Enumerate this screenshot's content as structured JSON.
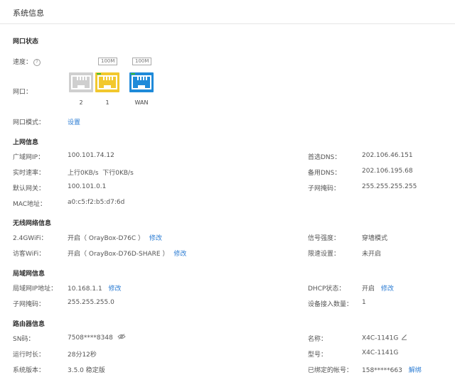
{
  "page_title": "系统信息",
  "port_status": {
    "heading": "网口状态",
    "speed_label": "速度：",
    "help_glyph": "?",
    "port_label": "网口：",
    "mode_label": "网口模式：",
    "mode_link": "设置",
    "ports": [
      {
        "name": "2",
        "speed": "",
        "color": "#cfcfcf"
      },
      {
        "name": "1",
        "speed": "100M",
        "color": "#f2c82e"
      },
      {
        "name": "WAN",
        "speed": "100M",
        "color": "#1f8ad9"
      }
    ]
  },
  "internet": {
    "heading": "上网信息",
    "left": [
      {
        "label": "广域网IP：",
        "value": "100.101.74.12"
      },
      {
        "label": "实时速率：",
        "value": "上行0KB/s  下行0KB/s"
      },
      {
        "label": "默认网关：",
        "value": "100.101.0.1"
      },
      {
        "label": "MAC地址：",
        "value": "a0:c5:f2:b5:d7:6d"
      }
    ],
    "right": [
      {
        "label": "首选DNS：",
        "value": "202.106.46.151"
      },
      {
        "label": "备用DNS：",
        "value": "202.106.195.68"
      },
      {
        "label": "子网掩码：",
        "value": "255.255.255.255"
      }
    ]
  },
  "wireless": {
    "heading": "无线网络信息",
    "wifi24_label": "2.4GWiFi：",
    "wifi24_value": "开启（ OrayBox-D76C ）",
    "wifi24_link": "修改",
    "guest_label": "访客WiFi：",
    "guest_value": "开启（ OrayBox-D76D-SHARE ）",
    "guest_link": "修改",
    "signal_label": "信号强度：",
    "signal_value": "穿墙模式",
    "limit_label": "限速设置：",
    "limit_value": "未开启"
  },
  "lan": {
    "heading": "局域网信息",
    "ip_label": "局域网IP地址：",
    "ip_value": "10.168.1.1",
    "ip_link": "修改",
    "mask_label": "子网掩码：",
    "mask_value": "255.255.255.0",
    "dhcp_label": "DHCP状态：",
    "dhcp_value": "开启",
    "dhcp_link": "修改",
    "devices_label": "设备接入数量：",
    "devices_value": "1"
  },
  "router": {
    "heading": "路由器信息",
    "sn_label": "SN码：",
    "sn_value": "7508****8348",
    "uptime_label": "运行时长：",
    "uptime_value": "28分12秒",
    "version_label": "系统版本：",
    "version_value": "3.5.0 稳定版",
    "name_label": "名称：",
    "name_value": "X4C-1141G",
    "model_label": "型号：",
    "model_value": "X4C-1141G",
    "account_label": "已绑定的帐号：",
    "account_value": "158*****663",
    "unbind_link": "解绑"
  },
  "icons": {
    "help": "help-circle-icon",
    "eye": "eye-hidden-icon",
    "edit": "pencil-icon",
    "port": "ethernet-port-icon"
  },
  "colors": {
    "link": "#2b7cd3",
    "heading": "#333333",
    "text": "#555555",
    "port_led": "#3bbf3b"
  }
}
